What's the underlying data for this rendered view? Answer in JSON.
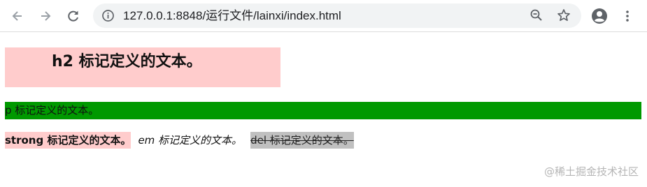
{
  "browser": {
    "url": "127.0.0.1:8848/运行文件/lainxi/index.html",
    "icons": {
      "back": "arrow-left-icon",
      "forward": "arrow-right-icon",
      "reload": "reload-icon",
      "site_info": "info-icon",
      "zoom": "zoom-out-icon",
      "bookmark": "star-icon",
      "profile": "account-icon",
      "menu": "more-vert-icon"
    }
  },
  "page": {
    "h2_text": "h2 标记定义的文本。",
    "p_text": "p 标记定义的文本。",
    "strong_text": "strong 标记定义的文本。",
    "em_text": "em 标记定义的文本。",
    "del_text": "del 标记定义的文本。"
  },
  "watermark": "@稀土掘金技术社区",
  "colors": {
    "h2_background": "#ffcccc",
    "p_background": "#009900",
    "strong_background": "#ffcccc",
    "del_background": "#c0c0c0"
  }
}
